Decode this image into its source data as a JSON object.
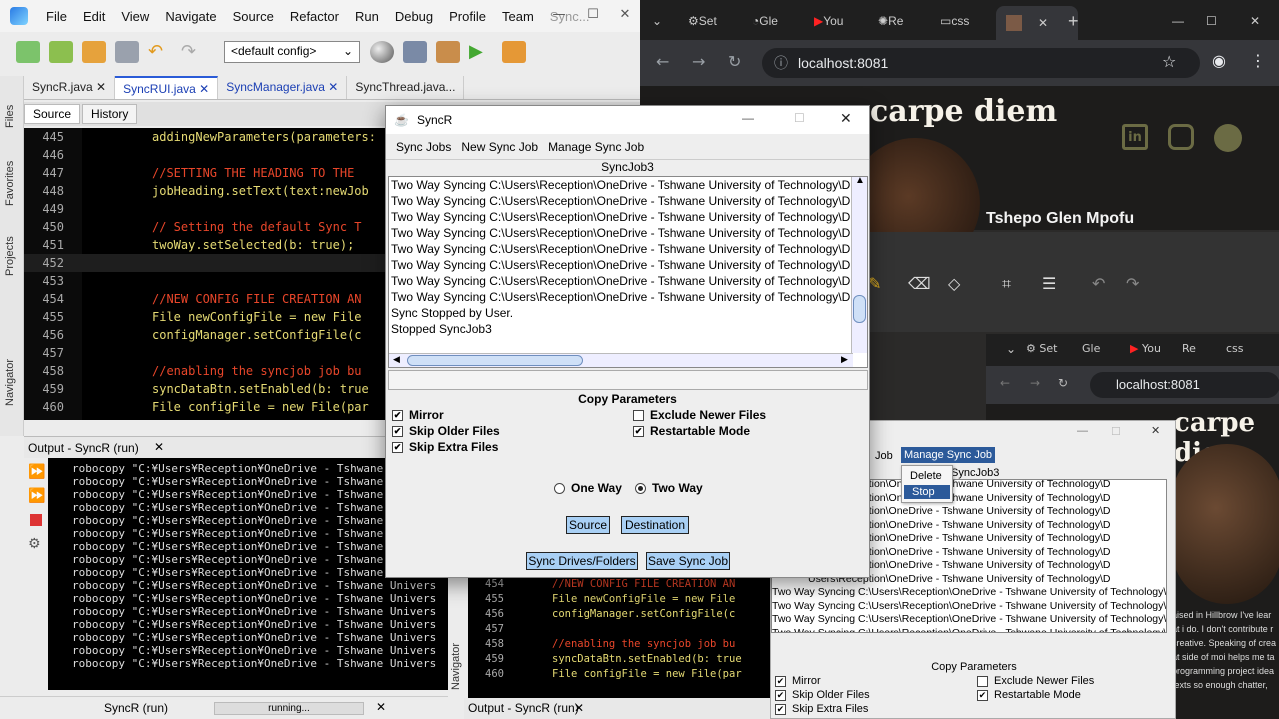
{
  "ide": {
    "menus": [
      "File",
      "Edit",
      "View",
      "Navigate",
      "Source",
      "Refactor",
      "Run",
      "Debug",
      "Profile",
      "Team",
      "Sync..."
    ],
    "config_select": "<default config>",
    "tabs": [
      "SyncR.java",
      "SyncRUI.java",
      "SyncManager.java",
      "SyncThread.java..."
    ],
    "side_labels": [
      "Files",
      "Favorites",
      "Projects",
      "Navigator"
    ],
    "source_tab": "Source",
    "history_tab": "History",
    "code_lines": [
      {
        "n": "445",
        "t": "addingNewParameters(parameters:"
      },
      {
        "n": "446",
        "t": ""
      },
      {
        "n": "447",
        "t": "//SETTING THE HEADING TO THE"
      },
      {
        "n": "448",
        "t": "jobHeading.setText(text:newJob"
      },
      {
        "n": "449",
        "t": ""
      },
      {
        "n": "450",
        "t": "// Setting the default Sync T"
      },
      {
        "n": "451",
        "t": "twoWay.setSelected(b: true);"
      },
      {
        "n": "452",
        "t": ""
      },
      {
        "n": "453",
        "t": ""
      },
      {
        "n": "454",
        "t": "//NEW CONFIG FILE CREATION AN"
      },
      {
        "n": "455",
        "t": "File newConfigFile = new File"
      },
      {
        "n": "456",
        "t": "configManager.setConfigFile(c"
      },
      {
        "n": "457",
        "t": ""
      },
      {
        "n": "458",
        "t": "//enabling the syncjob job bu"
      },
      {
        "n": "459",
        "t": "syncDataBtn.setEnabled(b: true"
      },
      {
        "n": "460",
        "t": "File configFile = new File(par"
      }
    ],
    "output_title": "Output - SyncR (run)",
    "output_line": "robocopy \"C:¥Users¥Reception¥OneDrive - Tshwane Univers",
    "status_project": "SyncR (run)",
    "status_running": "running..."
  },
  "browser": {
    "tabs": [
      "Set",
      "Gle",
      "You",
      "Re",
      "css",
      ""
    ],
    "url": "localhost:8081",
    "site_title": "carpe diem",
    "person_name": "Tshepo Glen Mpofu",
    "inner_url": "localhost:8081",
    "inner_site_title": "carpe die",
    "inner_bio": "aised in Hillbrow I've lear\nat i do. I don't contribute r\ncreative. Speaking of crea\nat side of moi helps me ta\nprogramming project idea\ntexts so enough chatter,"
  },
  "syncr": {
    "title": "SyncR",
    "menus": [
      "Sync Jobs",
      "New Sync Job",
      "Manage Sync Job"
    ],
    "job_name": "SyncJob3",
    "log_lines": [
      "Two Way Syncing C:\\Users\\Reception\\OneDrive - Tshwane University of Technology\\D",
      "Two Way Syncing C:\\Users\\Reception\\OneDrive - Tshwane University of Technology\\D",
      "Two Way Syncing C:\\Users\\Reception\\OneDrive - Tshwane University of Technology\\D",
      "Two Way Syncing C:\\Users\\Reception\\OneDrive - Tshwane University of Technology\\D",
      "Two Way Syncing C:\\Users\\Reception\\OneDrive - Tshwane University of Technology\\D",
      "Two Way Syncing C:\\Users\\Reception\\OneDrive - Tshwane University of Technology\\D",
      "Two Way Syncing C:\\Users\\Reception\\OneDrive - Tshwane University of Technology\\D",
      "Two Way Syncing C:\\Users\\Reception\\OneDrive - Tshwane University of Technology\\D",
      "Sync Stopped by User.",
      "Stopped SyncJob3"
    ],
    "params_title": "Copy Parameters",
    "checkboxes": [
      {
        "label": "Mirror",
        "checked": true
      },
      {
        "label": "Skip Older Files",
        "checked": true
      },
      {
        "label": "Skip Extra Files",
        "checked": true
      },
      {
        "label": "Exclude Newer Files",
        "checked": false
      },
      {
        "label": "Restartable Mode",
        "checked": true
      }
    ],
    "radio_one_way": "One Way",
    "radio_two_way": "Two Way",
    "selected_mode": "Two Way",
    "btn_source": "Source",
    "btn_destination": "Destination",
    "btn_sync": "Sync Drives/Folders",
    "btn_save": "Save Sync Job"
  },
  "inner_syncr": {
    "menu_partial": "Job",
    "menu_manage": "Manage Sync Job",
    "popup_items": [
      "Delete",
      "Stop"
    ],
    "job_name": "SyncJob3",
    "log_lines": [
      "Users\\Reception\\OneDrive - Tshwane University of Technology\\D",
      "Users\\Reception\\OneDrive - Tshwane University of Technology\\D",
      "Users\\Reception\\OneDrive - Tshwane University of Technology\\D",
      "Users\\Reception\\OneDrive - Tshwane University of Technology\\D",
      "Users\\Reception\\OneDrive - Tshwane University of Technology\\D",
      "Users\\Reception\\OneDrive - Tshwane University of Technology\\D",
      "Users\\Reception\\OneDrive - Tshwane University of Technology\\D",
      "Users\\Reception\\OneDrive - Tshwane University of Technology\\D",
      "Two Way Syncing C:\\Users\\Reception\\OneDrive - Tshwane University of Technology\\D",
      "Two Way Syncing C:\\Users\\Reception\\OneDrive - Tshwane University of Technology\\D",
      "Two Way Syncing C:\\Users\\Reception\\OneDrive - Tshwane University of Technology\\D",
      "Two Way Syncing C:\\Users\\Reception\\OneDrive - Tshwane University of Technology\\D"
    ],
    "params_title": "Copy Parameters",
    "checkboxes": [
      "Mirror",
      "Skip Older Files",
      "Skip Extra Files",
      "Exclude Newer Files",
      "Restartable Mode"
    ],
    "code_lines": [
      {
        "n": "454",
        "t": "//NEW CONFIG FILE CREATION AN"
      },
      {
        "n": "455",
        "t": "File newConfigFile = new File"
      },
      {
        "n": "456",
        "t": "configManager.setConfigFile(c"
      },
      {
        "n": "457",
        "t": ""
      },
      {
        "n": "458",
        "t": "//enabling the syncjob job bu"
      },
      {
        "n": "459",
        "t": "syncDataBtn.setEnabled(b: true"
      },
      {
        "n": "460",
        "t": "File configFile = new File(par"
      }
    ],
    "output_title": "Output - SyncR (run)"
  }
}
